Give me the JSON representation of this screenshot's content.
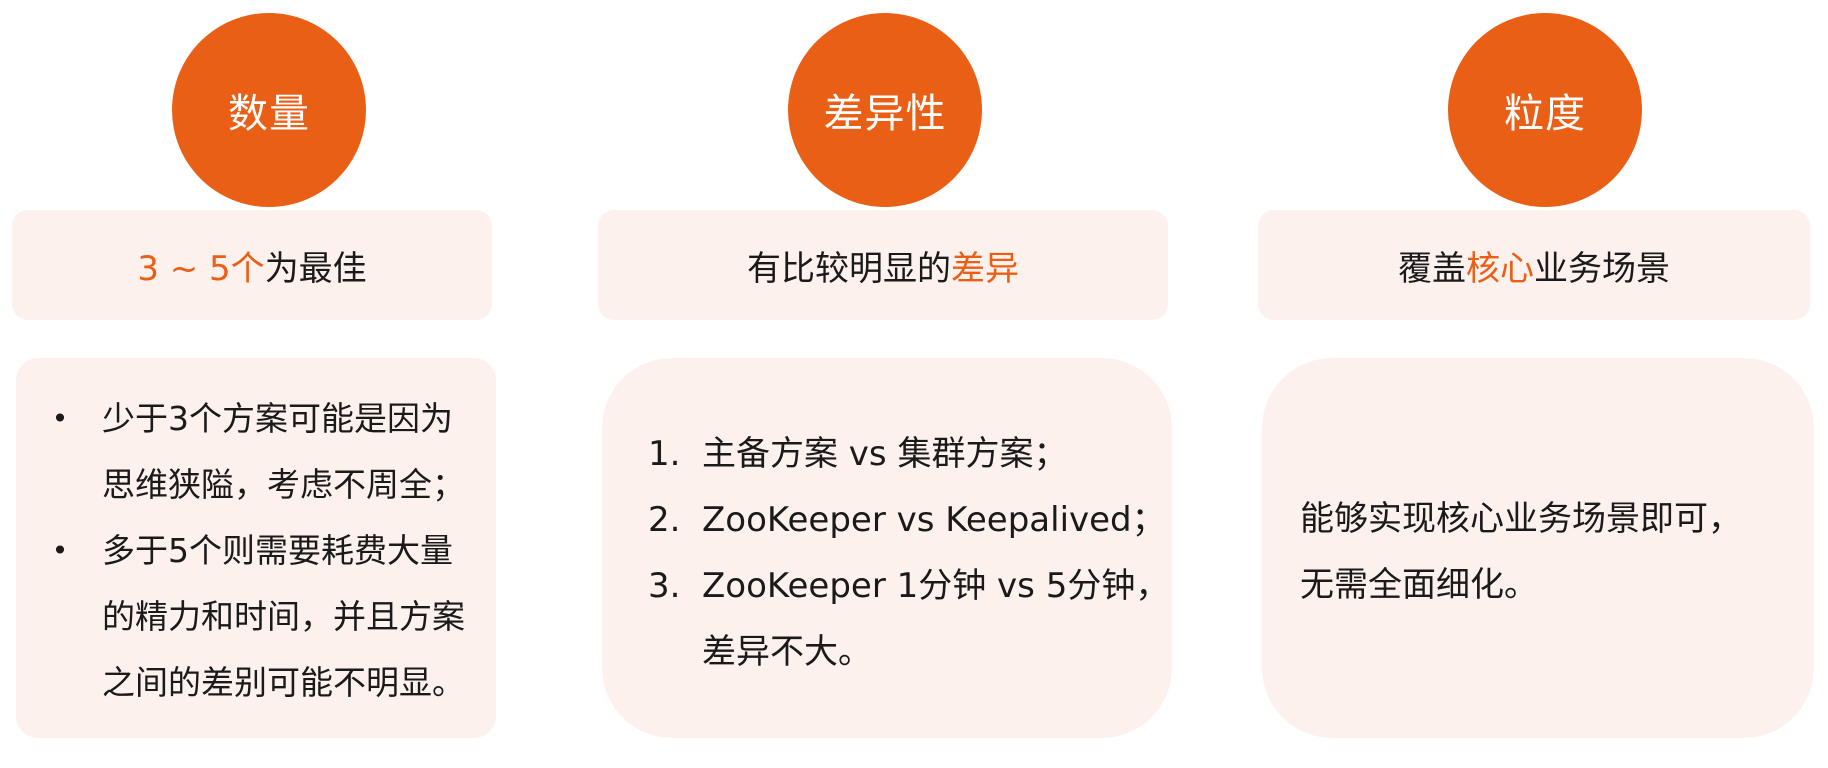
{
  "columns": [
    {
      "title": "数量",
      "summary": {
        "highlight": "3 ~ 5个",
        "rest": "为最佳"
      },
      "bullets": [
        "少于3个方案可能是因为思维狭隘，考虑不周全；",
        "多于5个则需要耗费大量的精力和时间，并且方案之间的差别可能不明显。"
      ]
    },
    {
      "title": "差异性",
      "summary": {
        "prefix": "有比较明显的",
        "highlight": "差异"
      },
      "items": [
        {
          "num": "1.",
          "lines": [
            "主备方案 vs 集群方案；"
          ]
        },
        {
          "num": "2.",
          "lines": [
            "ZooKeeper  vs Keepalived；"
          ]
        },
        {
          "num": "3.",
          "lines": [
            "ZooKeeper 1分钟 vs 5分钟，",
            "差异不大。"
          ]
        }
      ]
    },
    {
      "title": "粒度",
      "summary": {
        "prefix": "覆盖",
        "highlight": "核心",
        "suffix": "业务场景"
      },
      "text_lines": [
        "能够实现核心业务场景即可，",
        "无需全面细化。"
      ]
    }
  ],
  "colors": {
    "accent": "#ea5f16",
    "box_background": "#fdf1ee",
    "text": "#1a1a1a"
  }
}
